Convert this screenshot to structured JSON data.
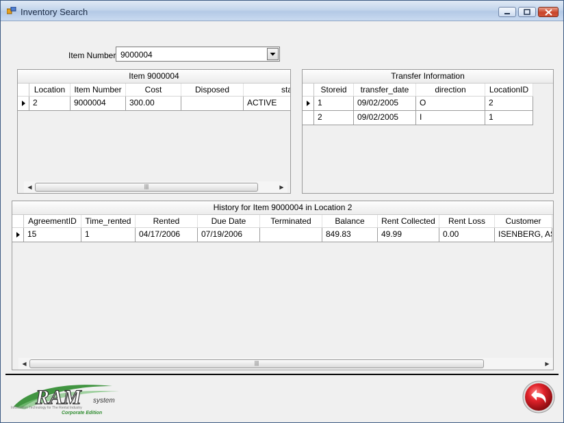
{
  "window": {
    "title": "Inventory Search",
    "controls": [
      "minimize",
      "maximize",
      "close"
    ]
  },
  "item_number": {
    "label": "Item Number:",
    "value": "9000004"
  },
  "item_grid": {
    "caption": "Item 9000004",
    "columns": [
      "Location",
      "Item Number",
      "Cost",
      "Disposed",
      "status"
    ],
    "rows": [
      [
        "2",
        "9000004",
        "300.00",
        "",
        "ACTIVE"
      ]
    ]
  },
  "transfer_grid": {
    "caption": "Transfer Information",
    "columns": [
      "Storeid",
      "transfer_date",
      "direction",
      "LocationID"
    ],
    "rows": [
      [
        "1",
        "09/02/2005",
        "O",
        "2"
      ],
      [
        "2",
        "09/02/2005",
        "I",
        "1"
      ]
    ]
  },
  "history_grid": {
    "caption": "History for Item 9000004 in Location 2",
    "columns": [
      "AgreementID",
      "Time_rented",
      "Rented",
      "Due Date",
      "Terminated",
      "Balance",
      "Rent Collected",
      "Rent Loss",
      "Customer"
    ],
    "rows": [
      [
        "15",
        "1",
        "04/17/2006",
        "07/19/2006",
        "",
        "849.83",
        "49.99",
        "0.00",
        "ISENBERG, ASI"
      ]
    ]
  },
  "logo": {
    "name": "RAM",
    "suffix": "system",
    "tagline": "Information Technology for The Rental Industry",
    "edition": "Corporate Edition"
  },
  "icons": {
    "back": "back-arrow-icon",
    "app": "app-icon"
  },
  "colors": {
    "back_button": "#c8141c",
    "logo_green": "#2e8b2e"
  }
}
